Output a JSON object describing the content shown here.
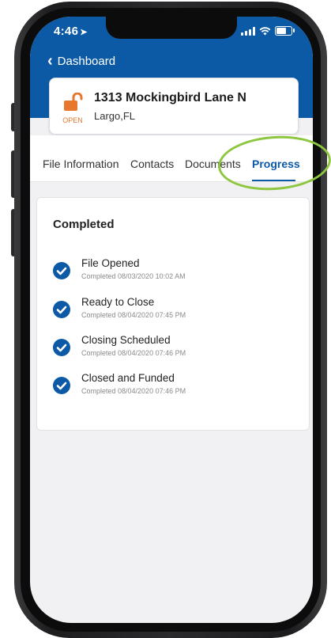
{
  "status_bar": {
    "time": "4:46",
    "location_arrow": "➤"
  },
  "header": {
    "back_label": "Dashboard",
    "back_icon": "chevron-left-icon"
  },
  "property": {
    "address": "1313 Mockingbird Lane N",
    "city": "Largo,FL",
    "status_label": "OPEN",
    "status_icon": "unlocked-padlock-icon",
    "status_color": "#e8772e"
  },
  "tabs": [
    {
      "label": "File Information",
      "active": false
    },
    {
      "label": "Contacts",
      "active": false
    },
    {
      "label": "Documents",
      "active": false
    },
    {
      "label": "Progress",
      "active": true
    }
  ],
  "progress": {
    "section_title": "Completed",
    "steps": [
      {
        "title": "File Opened",
        "subtitle": "Completed 08/03/2020 10:02 AM"
      },
      {
        "title": "Ready to Close",
        "subtitle": "Completed 08/04/2020 07:45 PM"
      },
      {
        "title": "Closing Scheduled",
        "subtitle": "Completed 08/04/2020 07:46 PM"
      },
      {
        "title": "Closed and Funded",
        "subtitle": "Completed 08/04/2020 07:46 PM"
      }
    ]
  },
  "colors": {
    "brand_blue": "#0c5aa6",
    "highlight_green": "#8dc63f",
    "open_orange": "#e8772e"
  }
}
